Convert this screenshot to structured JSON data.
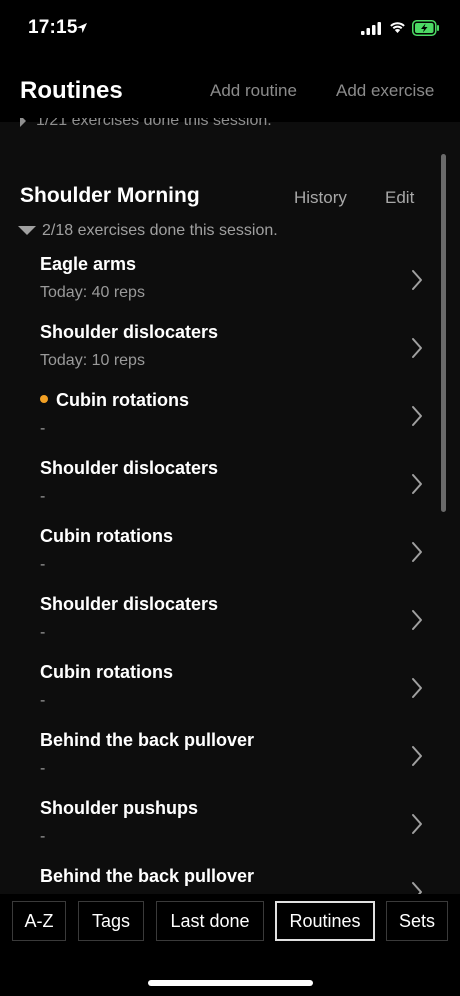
{
  "status": {
    "time": "17:15"
  },
  "header": {
    "title": "Routines",
    "add_routine": "Add routine",
    "add_exercise": "Add exercise"
  },
  "previous_summary": "1/21 exercises done this session.",
  "routine": {
    "title": "Shoulder Morning",
    "history": "History",
    "edit": "Edit",
    "summary": "2/18 exercises done this session.",
    "exercises": [
      {
        "name": "Eagle arms",
        "detail": "Today: 40 reps",
        "highlight": false
      },
      {
        "name": "Shoulder dislocaters",
        "detail": "Today: 10 reps",
        "highlight": false
      },
      {
        "name": "Cubin rotations",
        "detail": "-",
        "highlight": true
      },
      {
        "name": "Shoulder dislocaters",
        "detail": "-",
        "highlight": false
      },
      {
        "name": "Cubin rotations",
        "detail": "-",
        "highlight": false
      },
      {
        "name": "Shoulder dislocaters",
        "detail": "-",
        "highlight": false
      },
      {
        "name": "Cubin rotations",
        "detail": "-",
        "highlight": false
      },
      {
        "name": "Behind the back pullover",
        "detail": "-",
        "highlight": false
      },
      {
        "name": "Shoulder pushups",
        "detail": "-",
        "highlight": false
      },
      {
        "name": "Behind the back pullover",
        "detail": "",
        "highlight": false
      }
    ]
  },
  "tabs": {
    "az": "A-Z",
    "tags": "Tags",
    "last_done": "Last done",
    "routines": "Routines",
    "sets": "Sets",
    "active": "routines"
  },
  "colors": {
    "highlight_dot": "#f2a024",
    "battery": "#4cd964"
  }
}
